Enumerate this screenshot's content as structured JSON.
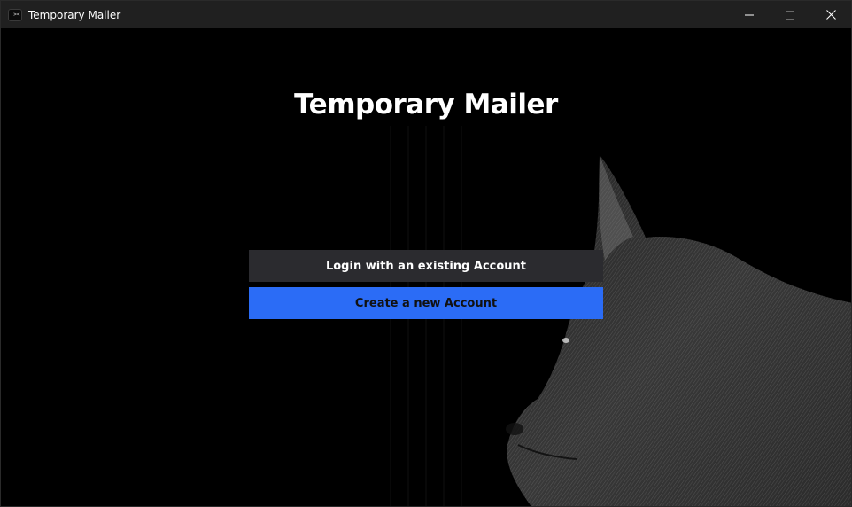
{
  "window": {
    "title": "Temporary Mailer",
    "app_icon_text": ":><"
  },
  "controls": {
    "minimize_icon": "minimize-icon",
    "maximize_icon": "maximize-icon",
    "close_icon": "close-icon"
  },
  "main": {
    "heading": "Temporary Mailer",
    "login_button": "Login with an existing Account",
    "create_button": "Create a new Account"
  },
  "colors": {
    "primary_button": "#2b6cf6",
    "secondary_button": "#2b2b2f",
    "background": "#000000",
    "titlebar": "#202020"
  }
}
